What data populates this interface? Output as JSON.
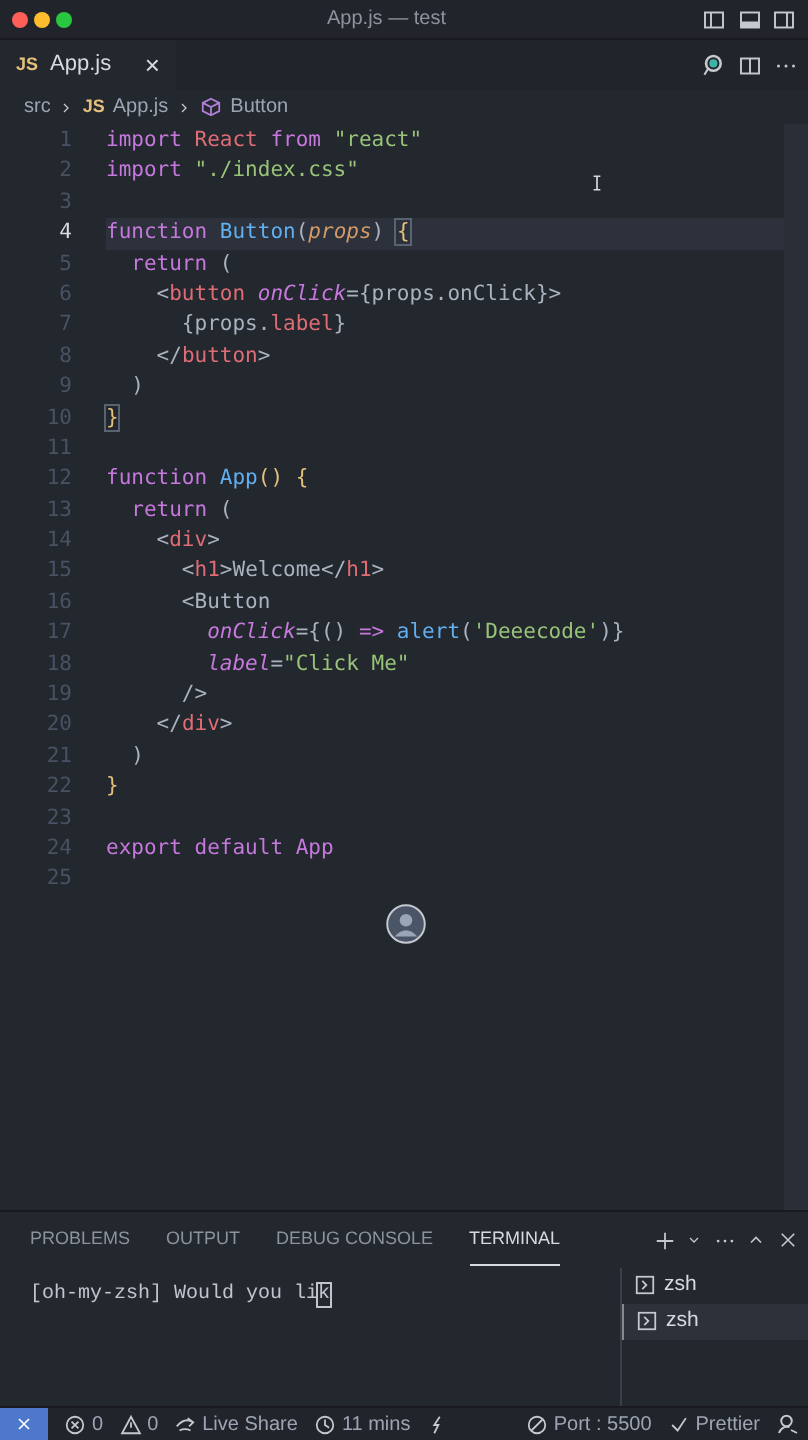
{
  "window": {
    "title": "App.js — test"
  },
  "tabs": [
    {
      "badge": "JS",
      "label": "App.js",
      "close": "×",
      "selected": true
    }
  ],
  "breadcrumb": [
    {
      "text": "src",
      "kind": "folder"
    },
    {
      "text": "App.js",
      "kind": "file"
    },
    {
      "text": "Button",
      "kind": "symbol"
    }
  ],
  "file_badge": "JS",
  "code": [
    {
      "number": "1",
      "current": false,
      "tokens": [
        {
          "text": "import ",
          "kind": "keyword"
        },
        {
          "text": "React ",
          "kind": "tag"
        },
        {
          "text": "from ",
          "kind": "keyword"
        },
        {
          "text": "\"react\"",
          "kind": "string"
        }
      ]
    },
    {
      "number": "2",
      "current": false,
      "tokens": [
        {
          "text": "import ",
          "kind": "keyword"
        },
        {
          "text": "\"./index.css\"",
          "kind": "string"
        }
      ]
    },
    {
      "number": "3",
      "current": false
    },
    {
      "number": "4",
      "current": true,
      "tokens": [
        {
          "text": "function ",
          "kind": "keyword"
        },
        {
          "text": "Button",
          "kind": "func"
        },
        {
          "text": "(",
          "kind": "punct"
        },
        {
          "text": "props",
          "kind": "param"
        },
        {
          "text": ") ",
          "kind": "punct"
        },
        {
          "text": "{",
          "kind": "match"
        }
      ]
    },
    {
      "number": "5",
      "current": false,
      "tokens": [
        {
          "text": "  return ",
          "kind": "keyword"
        },
        {
          "text": "(",
          "kind": "punct"
        }
      ]
    },
    {
      "number": "6",
      "current": false,
      "tokens": [
        {
          "text": "    <",
          "kind": "punct"
        },
        {
          "text": "button ",
          "kind": "tag"
        },
        {
          "text": "onClick",
          "kind": "attr"
        },
        {
          "text": "={props.onClick}>",
          "kind": "plain"
        }
      ]
    },
    {
      "number": "7",
      "current": false,
      "tokens": [
        {
          "text": "      {props.",
          "kind": "plain"
        },
        {
          "text": "label",
          "kind": "tag"
        },
        {
          "text": "}",
          "kind": "plain"
        }
      ]
    },
    {
      "number": "8",
      "current": false,
      "tokens": [
        {
          "text": "    </",
          "kind": "punct"
        },
        {
          "text": "button",
          "kind": "tag"
        },
        {
          "text": ">",
          "kind": "punct"
        }
      ]
    },
    {
      "number": "9",
      "current": false,
      "tokens": [
        {
          "text": "  )",
          "kind": "punct"
        }
      ]
    },
    {
      "number": "10",
      "current": false,
      "tokens": [
        {
          "text": "}",
          "kind": "match"
        }
      ]
    },
    {
      "number": "11",
      "current": false
    },
    {
      "number": "12",
      "current": false,
      "tokens": [
        {
          "text": "function ",
          "kind": "keyword"
        },
        {
          "text": "App",
          "kind": "func"
        },
        {
          "text": "() {",
          "kind": "bracket"
        }
      ]
    },
    {
      "number": "13",
      "current": false,
      "tokens": [
        {
          "text": "  return ",
          "kind": "keyword"
        },
        {
          "text": "(",
          "kind": "punct"
        }
      ]
    },
    {
      "number": "14",
      "current": false,
      "tokens": [
        {
          "text": "    <",
          "kind": "punct"
        },
        {
          "text": "div",
          "kind": "tag"
        },
        {
          "text": ">",
          "kind": "punct"
        }
      ]
    },
    {
      "number": "15",
      "current": false,
      "tokens": [
        {
          "text": "      <",
          "kind": "punct"
        },
        {
          "text": "h1",
          "kind": "tag"
        },
        {
          "text": ">Welcome</",
          "kind": "plain"
        },
        {
          "text": "h1",
          "kind": "tag"
        },
        {
          "text": ">",
          "kind": "punct"
        }
      ]
    },
    {
      "number": "16",
      "current": false,
      "tokens": [
        {
          "text": "      <Button",
          "kind": "plain"
        }
      ]
    },
    {
      "number": "17",
      "current": false,
      "tokens": [
        {
          "text": "        onClick",
          "kind": "attr"
        },
        {
          "text": "={() ",
          "kind": "plain"
        },
        {
          "text": "=> ",
          "kind": "keyword"
        },
        {
          "text": "alert",
          "kind": "func"
        },
        {
          "text": "(",
          "kind": "plain"
        },
        {
          "text": "'Deeecode'",
          "kind": "string"
        },
        {
          "text": ")}",
          "kind": "plain"
        }
      ]
    },
    {
      "number": "18",
      "current": false,
      "tokens": [
        {
          "text": "        label",
          "kind": "attr"
        },
        {
          "text": "=",
          "kind": "plain"
        },
        {
          "text": "\"Click Me\"",
          "kind": "string"
        }
      ]
    },
    {
      "number": "19",
      "current": false,
      "tokens": [
        {
          "text": "      />",
          "kind": "punct"
        }
      ]
    },
    {
      "number": "20",
      "current": false,
      "tokens": [
        {
          "text": "    </",
          "kind": "punct"
        },
        {
          "text": "div",
          "kind": "tag"
        },
        {
          "text": ">",
          "kind": "punct"
        }
      ]
    },
    {
      "number": "21",
      "current": false,
      "tokens": [
        {
          "text": "  )",
          "kind": "punct"
        }
      ]
    },
    {
      "number": "22",
      "current": false,
      "tokens": [
        {
          "text": "}",
          "kind": "bracket"
        }
      ]
    },
    {
      "number": "23",
      "current": false
    },
    {
      "number": "24",
      "current": false,
      "tokens": [
        {
          "text": "export ",
          "kind": "keyword"
        },
        {
          "text": "default ",
          "kind": "keyword"
        },
        {
          "text": "App",
          "kind": "keyword"
        }
      ]
    },
    {
      "number": "25",
      "current": false
    }
  ],
  "panel": {
    "tabs": [
      {
        "label": "PROBLEMS",
        "selected": false
      },
      {
        "label": "OUTPUT",
        "selected": false
      },
      {
        "label": "DEBUG CONSOLE",
        "selected": false
      },
      {
        "label": "TERMINAL",
        "selected": true
      }
    ],
    "terminal_text": "[oh-my-zsh] Would you li",
    "cursor_char": "k",
    "terminals": [
      {
        "label": "zsh",
        "selected": false
      },
      {
        "label": "zsh",
        "selected": true
      }
    ]
  },
  "status_bar": [
    {
      "text": "0",
      "kind": "errors"
    },
    {
      "text": "0",
      "kind": "warnings"
    },
    {
      "text": "Live Share",
      "kind": "share"
    },
    {
      "text": "11 mins",
      "kind": "clock"
    },
    {
      "text": "Port : 5500",
      "kind": "port"
    },
    {
      "text": "Prettier",
      "kind": "check"
    }
  ]
}
